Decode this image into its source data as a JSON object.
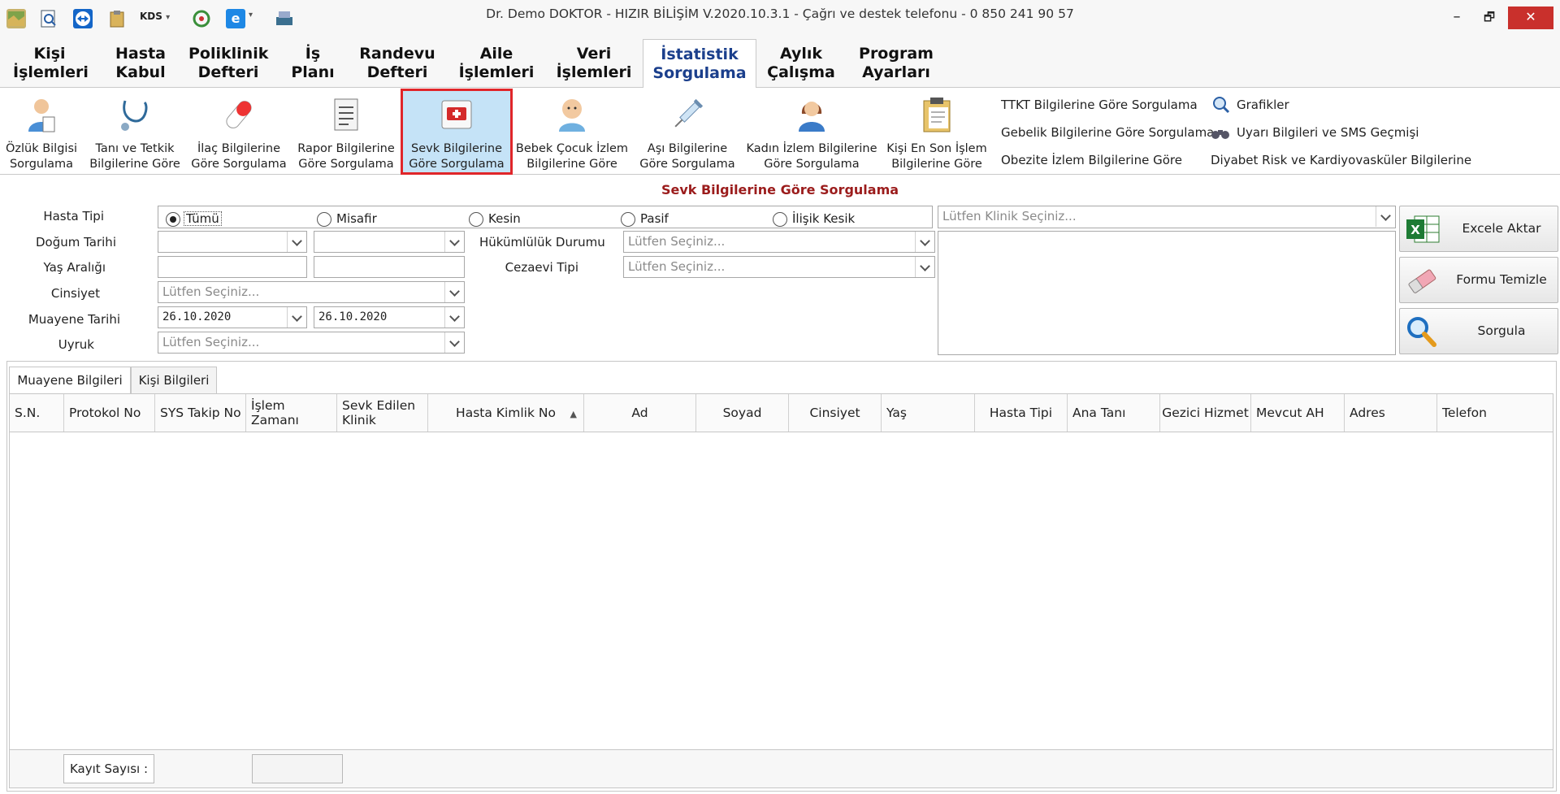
{
  "window": {
    "title": "Dr. Demo DOKTOR - HIZIR BİLİŞİM V.2020.10.3.1 - Çağrı ve destek telefonu - 0 850 241 90 57",
    "quick_access": [
      {
        "icon": "map-icon"
      },
      {
        "icon": "search-doc-icon"
      },
      {
        "icon": "teamviewer-icon"
      },
      {
        "icon": "clipboard-icon"
      },
      {
        "icon": "kds-icon",
        "label": "KDS"
      },
      {
        "icon": "recycle-icon"
      },
      {
        "icon": "e-icon"
      },
      {
        "icon": "scanner-icon"
      }
    ],
    "controls": {
      "minimize": "–",
      "restore": "🗗",
      "close": "✕"
    }
  },
  "tabs": [
    {
      "label": "Kişi\nİşlemleri"
    },
    {
      "label": "Hasta\nKabul"
    },
    {
      "label": "Poliklinik\nDefteri"
    },
    {
      "label": "İş\nPlanı"
    },
    {
      "label": "Randevu\nDefteri"
    },
    {
      "label": "Aile\nİşlemleri"
    },
    {
      "label": "Veri\nİşlemleri"
    },
    {
      "label": "İstatistik\nSorgulama"
    },
    {
      "label": "Aylık\nÇalışma"
    },
    {
      "label": "Program\nAyarları"
    }
  ],
  "ribbon": {
    "buttons": [
      {
        "label": "Özlük Bilgisi\nSorgulama",
        "icon": "doctor-icon"
      },
      {
        "label": "Tanı ve Tetkik\nBilgilerine Göre",
        "icon": "stethoscope-icon"
      },
      {
        "label": "İlaç Bilgilerine\nGöre Sorgulama",
        "icon": "pill-icon"
      },
      {
        "label": "Rapor Bilgilerine\nGöre Sorgulama",
        "icon": "report-icon"
      },
      {
        "label": "Sevk Bilgilerine\nGöre Sorgulama",
        "icon": "ambulance-icon"
      },
      {
        "label": "Bebek Çocuk İzlem\nBilgilerine Göre",
        "icon": "baby-icon"
      },
      {
        "label": "Aşı Bilgilerine\nGöre Sorgulama",
        "icon": "syringe-icon"
      },
      {
        "label": "Kadın İzlem Bilgilerine\nGöre Sorgulama",
        "icon": "woman-icon"
      },
      {
        "label": "Kişi En Son İşlem\nBilgilerine Göre",
        "icon": "clipboard-list-icon"
      }
    ],
    "links": [
      {
        "label": "TTKT Bilgilerine Göre Sorgulama"
      },
      {
        "label": "Gebelik Bilgilerine Göre Sorgulama"
      },
      {
        "label": "Obezite İzlem Bilgilerine Göre"
      },
      {
        "label": "Grafikler",
        "icon": "magnifier-icon"
      },
      {
        "label": "Uyarı Bilgileri ve SMS Geçmişi",
        "icon": "binoculars-icon"
      },
      {
        "label": "Diyabet Risk ve Kardiyovasküler Bilgilerine"
      }
    ]
  },
  "form": {
    "title": "Sevk Bilgilerine Göre Sorgulama",
    "labels": {
      "hasta_tipi": "Hasta Tipi",
      "dogum_tarihi": "Doğum Tarihi",
      "yas_araligi": "Yaş Aralığı",
      "cinsiyet": "Cinsiyet",
      "muayene_tarihi": "Muayene Tarihi",
      "uyruk": "Uyruk",
      "hukumluluk": "Hükümlülük Durumu",
      "cezaevi": "Cezaevi Tipi"
    },
    "hasta_tipi_options": [
      "Tümü",
      "Misafir",
      "Kesin",
      "Pasif",
      "İlişik Kesik"
    ],
    "hasta_tipi_selected": "Tümü",
    "placeholder": "Lütfen Seçiniz...",
    "klinik_placeholder": "Lütfen Klinik Seçiniz...",
    "muayene_start": "26.10.2020",
    "muayene_end": "26.10.2020"
  },
  "actions": {
    "excel": "Excele Aktar",
    "clear": "Formu Temizle",
    "query": "Sorgula"
  },
  "grid": {
    "tabs": [
      "Muayene Bilgileri",
      "Kişi Bilgileri"
    ],
    "active_tab": "Muayene Bilgileri",
    "columns": [
      "S.N.",
      "Protokol No",
      "SYS Takip No",
      "İşlem Zamanı",
      "Sevk Edilen Klinik",
      "Hasta Kimlik No",
      "Ad",
      "Soyad",
      "Cinsiyet",
      "Yaş",
      "Hasta Tipi",
      "Ana Tanı",
      "Gezici Hizmet",
      "Mevcut AH",
      "Adres",
      "Telefon"
    ],
    "sort_column": "Hasta Kimlik No",
    "sort_direction": "asc",
    "rows": []
  },
  "footer": {
    "record_count_label": "Kayıt Sayısı :",
    "record_count_value": ""
  },
  "colors": {
    "accent": "#1b3f8c",
    "title_red": "#9b1c1c",
    "selected_bg": "#c5e3f7",
    "selected_border": "#e0262a"
  }
}
